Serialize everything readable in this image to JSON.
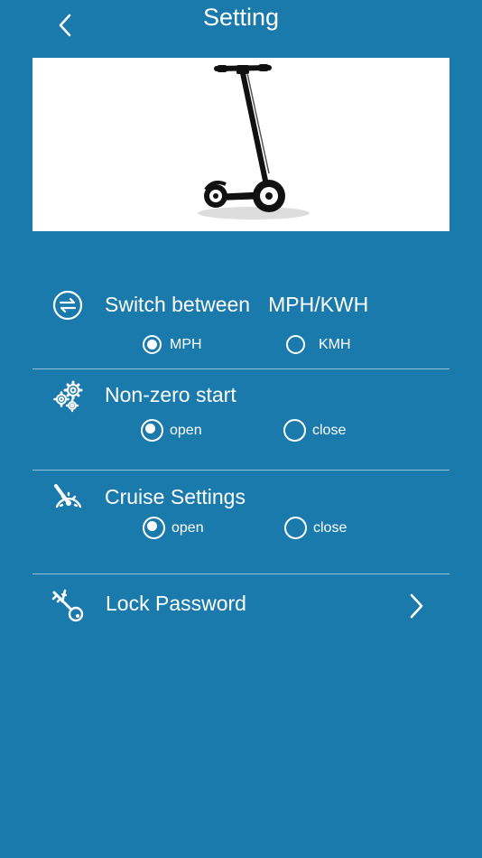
{
  "header": {
    "title": "Setting"
  },
  "units": {
    "title": "Switch between",
    "title_suffix": "MPH/KWH",
    "option_1": "MPH",
    "option_2": "KMH",
    "selected": "MPH"
  },
  "non_zero_start": {
    "title": "Non-zero start",
    "option_1": "open",
    "option_2": "close",
    "selected": "open"
  },
  "cruise": {
    "title": "Cruise Settings",
    "option_1": "open",
    "option_2": "close",
    "selected": "open"
  },
  "lock": {
    "title": "Lock Password"
  },
  "colors": {
    "background": "#1a7aac",
    "foreground": "#ffffff"
  }
}
